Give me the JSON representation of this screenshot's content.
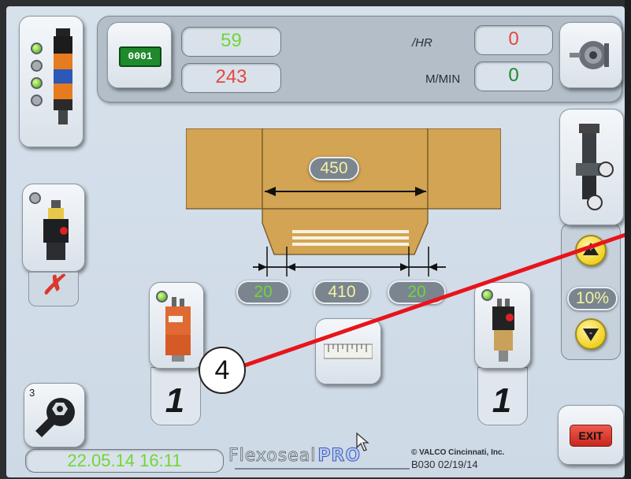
{
  "counters": {
    "icon_text": "0001",
    "count_green": "59",
    "count_red": "243"
  },
  "rates": {
    "per_hour_label": "/HR",
    "per_hour_value": "0",
    "speed_label": "M/MIN",
    "speed_value": "0"
  },
  "layout": {
    "total_length": "450",
    "left_margin": "20",
    "bead_length": "410",
    "right_margin": "20"
  },
  "left_valve": {
    "status": "✗"
  },
  "gun_left": {
    "count": "1"
  },
  "gun_right": {
    "count": "1"
  },
  "pressure": {
    "percent": "10%",
    "up_label": "+",
    "down_label": "-"
  },
  "callout": {
    "number": "4"
  },
  "footer": {
    "datetime": "22.05.14 16:11",
    "brand_main": "Flexoseal",
    "brand_pro": "PRO",
    "copyright": "© VALCO Cincinnati, Inc.",
    "version": "B030 02/19/14",
    "exit_label": "EXIT",
    "service_badge": "3"
  },
  "colors": {
    "green_value": "#6fd63a",
    "red_value": "#e4473f",
    "label_yellow": "#f4f1a0",
    "cardboard": "#d2a453",
    "exit_red": "#d6362b",
    "callout_red": "#e8141b"
  }
}
